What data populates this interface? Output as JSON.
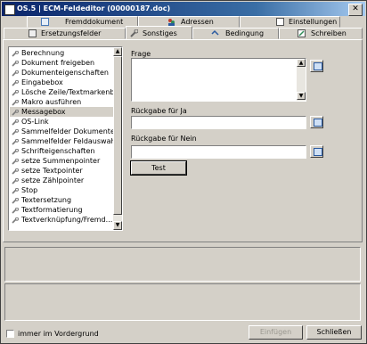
{
  "window": {
    "title": "OS.5 | ECM-Feldeditor (00000187.doc)",
    "close_glyph": "✕"
  },
  "tabs_top": [
    {
      "label": "Fremddokument"
    },
    {
      "label": "Adressen"
    },
    {
      "label": "Einstellungen"
    }
  ],
  "tabs_bottom": [
    {
      "label": "Ersetzungsfelder"
    },
    {
      "label": "Sonstiges"
    },
    {
      "label": "Bedingung"
    },
    {
      "label": "Schreiben"
    }
  ],
  "list": {
    "items": [
      "Berechnung",
      "Dokument freigeben",
      "Dokumenteigenschaften",
      "Eingabebox",
      "Lösche Zeile/Textmarkenbe...",
      "Makro ausführen",
      "Messagebox",
      "OS-Link",
      "Sammelfelder Dokumententyp",
      "Sammelfelder Feldauswahl",
      "Schrifteigenschaften",
      "setze Summenpointer",
      "setze Textpointer",
      "setze Zählpointer",
      "Stop",
      "Textersetzung",
      "Textformatierung",
      "Textverknüpfung/Fremd..."
    ],
    "selected": "Messagebox"
  },
  "form": {
    "frage_label": "Frage",
    "frage_value": "",
    "ja_label": "Rückgabe für Ja",
    "ja_value": "",
    "nein_label": "Rückgabe für Nein",
    "nein_value": "",
    "test_label": "Test"
  },
  "footer": {
    "checkbox_label": "immer im Vordergrund",
    "checkbox_checked": false,
    "insert_label": "Einfügen",
    "close_label": "Schließen"
  }
}
